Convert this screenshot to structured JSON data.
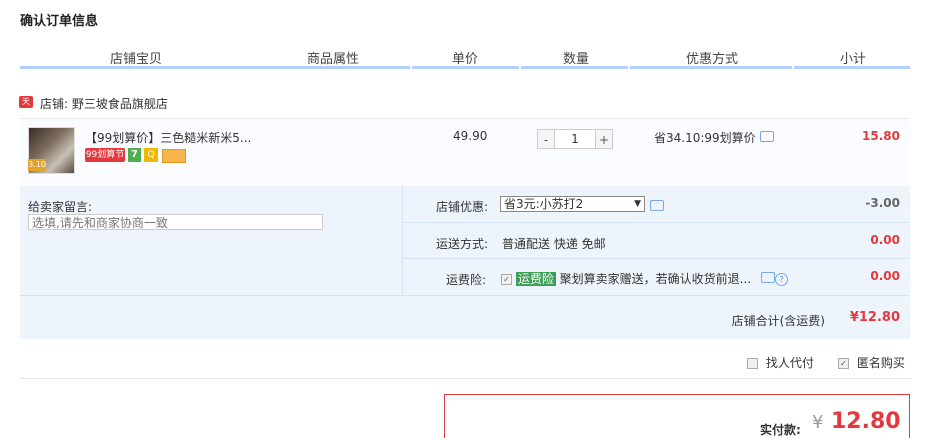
{
  "page": {
    "title": "确认订单信息"
  },
  "columns": [
    "店铺宝贝",
    "商品属性",
    "单价",
    "数量",
    "优惠方式",
    "小计"
  ],
  "shop": {
    "badge": "天猫",
    "name": "店铺: 野三坡食品旗舰店"
  },
  "item": {
    "title": "【99划算价】三色糙米新米5...",
    "thumb_tag": "3.10",
    "badges": {
      "promo": "99划算节",
      "seven": "7",
      "q": "Q"
    },
    "unit_price": "49.90",
    "quantity": "1",
    "qty_minus": "-",
    "qty_plus": "+",
    "discount": "省34.10:99划算价",
    "subtotal": "15.80"
  },
  "message": {
    "label": "给卖家留言:",
    "placeholder": "选填,请先和商家协商一致"
  },
  "shop_discount": {
    "label": "店铺优惠:",
    "selected": "省3元:小苏打2",
    "value": "-3.00"
  },
  "shipping": {
    "label": "运送方式:",
    "text": "普通配送 快递 免邮",
    "value": "0.00"
  },
  "insurance": {
    "label": "运费险:",
    "tag": "运费险",
    "text": "聚划算卖家赠送，若确认收货前退...",
    "value": "0.00"
  },
  "shop_total": {
    "label": "店铺合计(含运费)",
    "value": "¥12.80"
  },
  "options": {
    "proxy_pay": "找人代付",
    "anonymous": "匿名购买"
  },
  "payment": {
    "label": "实付款:",
    "currency": "¥",
    "value": "12.80"
  }
}
